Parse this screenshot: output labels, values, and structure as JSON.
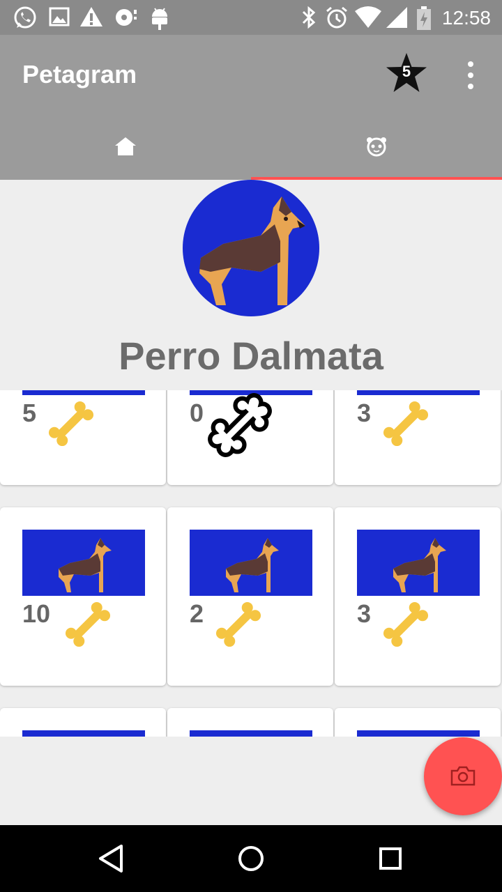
{
  "status_bar": {
    "time": "12:58",
    "icons": [
      "whatsapp-icon",
      "image-icon",
      "warning-icon",
      "media-icon",
      "android-icon",
      "bluetooth-icon",
      "alarm-icon",
      "wifi-icon",
      "signal-icon",
      "battery-icon"
    ]
  },
  "app_bar": {
    "title": "Petagram",
    "star_count": "5",
    "menu_icon": "overflow-menu-icon"
  },
  "tabs": [
    {
      "icon": "home-icon",
      "selected": false
    },
    {
      "icon": "dog-face-icon",
      "selected": true
    }
  ],
  "colors": {
    "accent": "#ff5252",
    "photo_bg": "#1a2bd1",
    "bone_yellow": "#f5c542",
    "appbar": "#9b9b9b"
  },
  "profile": {
    "name": "Perro Dalmata"
  },
  "grid": {
    "items": [
      {
        "count": "5",
        "bone": "yellow-bone-icon"
      },
      {
        "count": "0",
        "bone": "outline-bone-icon"
      },
      {
        "count": "3",
        "bone": "yellow-bone-icon"
      },
      {
        "count": "10",
        "bone": "yellow-bone-icon"
      },
      {
        "count": "2",
        "bone": "yellow-bone-icon"
      },
      {
        "count": "3",
        "bone": "yellow-bone-icon"
      }
    ]
  },
  "fab": {
    "icon": "camera-icon"
  },
  "nav_bar": {
    "icons": [
      "back-icon",
      "home-circle-icon",
      "recents-icon"
    ]
  }
}
